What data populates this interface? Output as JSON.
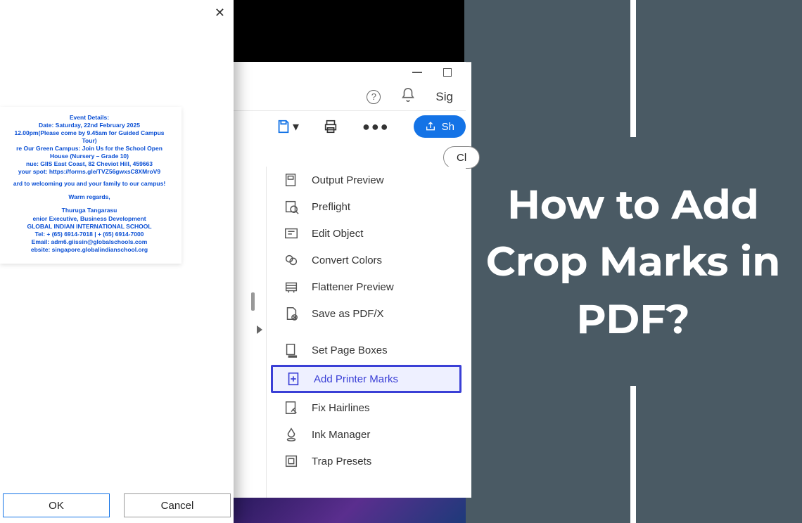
{
  "headline": "How to Add Crop Marks in PDF?",
  "header": {
    "sign_label": "Sig"
  },
  "toolbar": {
    "share_label": "Sh"
  },
  "close_panel_label": "Cl",
  "tools": {
    "output_preview": "Output Preview",
    "preflight": "Preflight",
    "edit_object": "Edit Object",
    "convert_colors": "Convert Colors",
    "flattener_preview": "Flattener Preview",
    "save_pdf_x": "Save as PDF/X",
    "set_page_boxes": "Set Page Boxes",
    "add_printer_marks": "Add Printer Marks",
    "fix_hairlines": "Fix Hairlines",
    "ink_manager": "Ink Manager",
    "trap_presets": "Trap Presets"
  },
  "dialog": {
    "ok_label": "OK",
    "cancel_label": "Cancel",
    "doc": {
      "l1": "Event Details:",
      "l2": "Date: Saturday, 22nd February 2025",
      "l3": "12.00pm(Please come by 9.45am for Guided Campus",
      "l4": "Tour)",
      "l5": "re Our Green Campus: Join Us for the School Open",
      "l6": "House (Nursery – Grade 10)",
      "l7": "nue: GIIS East Coast, 82 Cheviot Hill, 459663",
      "l8": "your spot: https://forms.gle/TVZ56gwxsC8XMroV9",
      "l9": "ard to welcoming you and your family to our campus!",
      "l10": "Warm regards,",
      "l11": "Thuruga Tangarasu",
      "l12": "enior Executive, Business Development",
      "l13": "GLOBAL INDIAN INTERNATIONAL SCHOOL",
      "l14": "Tel: + (65) 6914-7018 | + (65) 6914-7000",
      "l15": "Email: adm6.giissin@globalschools.com",
      "l16": "ebsite: singapore.globalindianschool.org"
    }
  }
}
